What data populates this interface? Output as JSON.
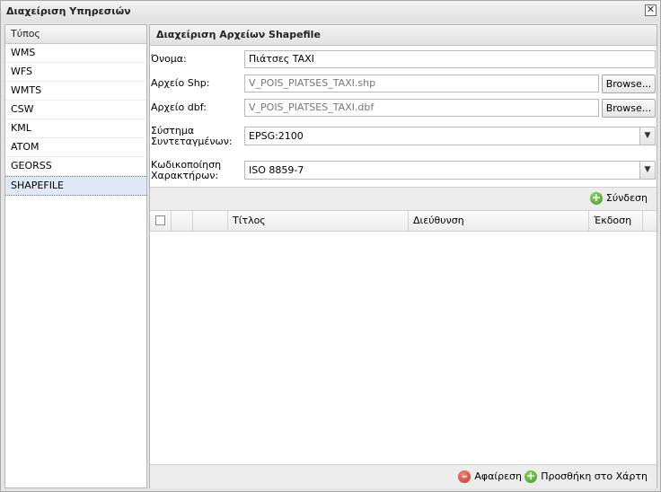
{
  "window": {
    "title": "Διαχείριση Υπηρεσιών",
    "close_glyph": "✕"
  },
  "left_panel": {
    "header": "Τύπος",
    "items": [
      {
        "label": "WMS"
      },
      {
        "label": "WFS"
      },
      {
        "label": "WMTS"
      },
      {
        "label": "CSW"
      },
      {
        "label": "KML"
      },
      {
        "label": "ATOM"
      },
      {
        "label": "GEORSS"
      },
      {
        "label": "SHAPEFILE",
        "selected": true
      }
    ]
  },
  "right_panel": {
    "header": "Διαχείριση Αρχείων Shapefile",
    "form": {
      "name_label": "Όνομα:",
      "name_value": "Πιάτσες TAXI",
      "shp_label": "Αρχείο Shp:",
      "shp_value": "V_POIS_PIATSES_TAXI.shp",
      "dbf_label": "Αρχείο dbf:",
      "dbf_value": "V_POIS_PIATSES_TAXI.dbf",
      "browse_label": "Browse...",
      "crs_label_1": "Σύστημα",
      "crs_label_2": "Συντεταγμένων:",
      "crs_value": "EPSG:2100",
      "enc_label_1": "Κωδικοποίηση",
      "enc_label_2": "Χαρακτήρων:",
      "enc_value": "ISO 8859-7"
    },
    "connect_label": "Σύνδεση",
    "grid": {
      "columns": [
        "Τίτλος",
        "Διεύθυνση",
        "Έκδοση"
      ],
      "rows": []
    },
    "remove_label": "Αφαίρεση",
    "add_to_map_label": "Προσθήκη στο Χάρτη"
  },
  "icons": {
    "add": "plus-circle-green",
    "remove": "minus-circle-red"
  },
  "colors": {
    "selection": "#dfe8f6",
    "add_green": "#3f9a22",
    "remove_red": "#c82c20"
  }
}
